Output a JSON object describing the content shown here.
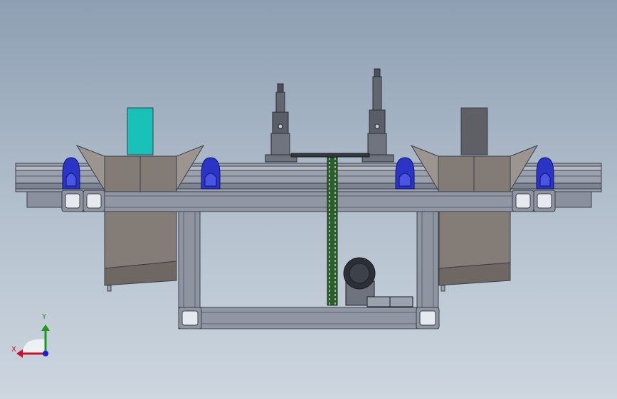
{
  "triad": {
    "x_label": "X",
    "y_label": "Y",
    "x_color": "#c8102e",
    "y_color": "#1a9a1a",
    "z_color": "#1a1ae0"
  },
  "colors": {
    "background_top": "#8e9fb3",
    "background_bottom": "#cdd6df",
    "frame_steel": "#8c94a3",
    "frame_edge": "#3a3f4a",
    "hopper": "#8a817a",
    "bearing_block": "#2a35c8",
    "teal_part": "#18c2b8",
    "grey_part": "#5e6066",
    "chain": "#3d8a3d",
    "motor": "#2c2f36"
  }
}
